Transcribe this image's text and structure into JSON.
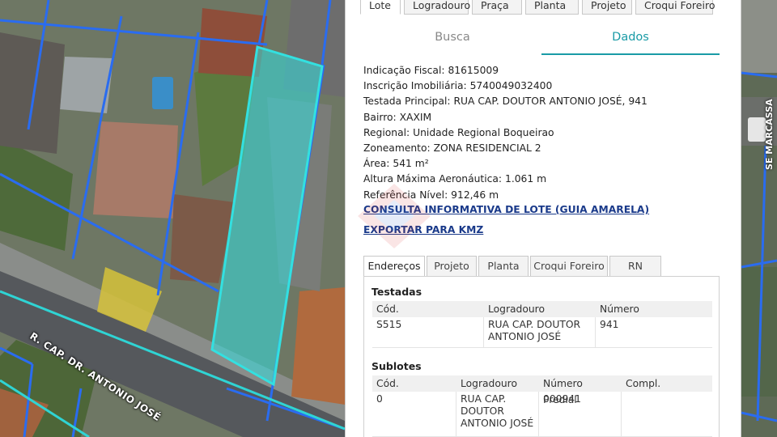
{
  "top_tabs": [
    "Lote",
    "Logradouro",
    "Praça",
    "Planta",
    "Projeto",
    "Croqui Foreiro"
  ],
  "sub_tabs": [
    "Busca",
    "Dados"
  ],
  "info": [
    {
      "label": "Indicação Fiscal:",
      "value": "81615009"
    },
    {
      "label": "Inscrição Imobiliária:",
      "value": "5740049032400"
    },
    {
      "label": "Testada Principal:",
      "value": "RUA CAP. DOUTOR ANTONIO JOSÉ, 941"
    },
    {
      "label": "Bairro:",
      "value": "XAXIM"
    },
    {
      "label": "Regional:",
      "value": "Unidade Regional Boqueirao"
    },
    {
      "label": "Zoneamento:",
      "value": "ZONA RESIDENCIAL 2"
    },
    {
      "label": "Área:",
      "value": "541 m²"
    },
    {
      "label": "Altura Máxima Aeronáutica:",
      "value": "1.061 m"
    },
    {
      "label": "Referência Nível:",
      "value": "912,46 m"
    }
  ],
  "links": {
    "consulta": "CONSULTA INFORMATIVA DE LOTE (GUIA AMARELA)",
    "exportar": "EXPORTAR PARA KMZ"
  },
  "bottom_tabs": [
    "Endereços",
    "Projeto",
    "Planta",
    "Croqui Foreiro",
    "RN"
  ],
  "testadas": {
    "title": "Testadas",
    "headers": [
      "Cód.",
      "Logradouro",
      "Número"
    ],
    "rows": [
      [
        "S515",
        "RUA CAP. DOUTOR ANTONIO JOSÉ",
        "941"
      ]
    ]
  },
  "sublotes": {
    "title": "Sublotes",
    "headers": [
      "Cód.",
      "Logradouro",
      "Número Predial",
      "Compl."
    ],
    "rows": [
      [
        "0",
        "RUA CAP. DOUTOR ANTONIO JOSÉ",
        "000941",
        ""
      ]
    ]
  },
  "map": {
    "street_label": "R. CAP. DR. ANTONIO JOSÉ",
    "street_label_right": "SE MARCASSA"
  },
  "colors": {
    "accent": "#1a9ba6",
    "link": "#1a3a8a",
    "parcel_outline": "#2a6cf0",
    "selected_parcel": "#33e0e0"
  }
}
